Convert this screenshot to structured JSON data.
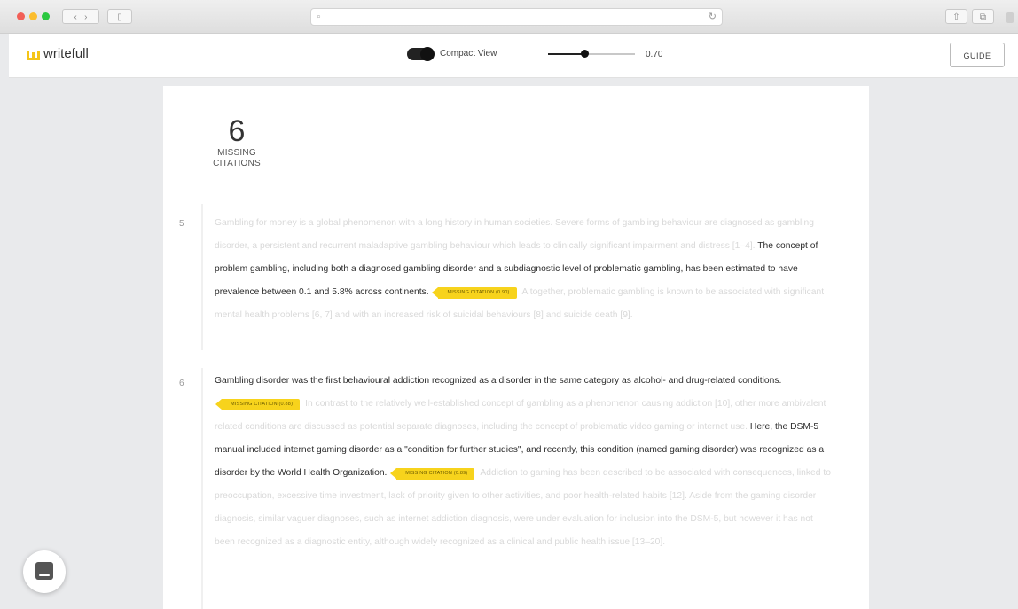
{
  "browser": {
    "url": ""
  },
  "app": {
    "name": "writefull"
  },
  "toolbar": {
    "compact_view_label": "Compact View",
    "compact_view_on": true,
    "slider_value": "0.70",
    "slider_fraction": 0.42,
    "guide_label": "GUIDE"
  },
  "counter": {
    "number": "6",
    "label_line1": "MISSING",
    "label_line2": "CITATIONS"
  },
  "paragraphs": [
    {
      "number": "5",
      "segments": [
        {
          "text": "Gambling for money is a global phenomenon with a long history in human societies. Severe forms of gambling behaviour are diagnosed as gambling disorder, a persistent and recurrent maladaptive gambling behaviour which leads to clinically significant impairment and distress [1–4].",
          "style": "faded"
        },
        {
          "text": "The concept of problem gambling, including both a diagnosed gambling disorder and a subdiagnostic level of problematic gambling, has been estimated to have prevalence between 0.1 and 5.8% across continents.",
          "style": "normal"
        },
        {
          "text": "MISSING CITATION (0.90)",
          "style": "tag"
        },
        {
          "text": "Altogether, problematic gambling is known to be associated with significant mental health problems [6, 7] and with an increased risk of suicidal behaviours [8] and suicide death [9].",
          "style": "faded"
        }
      ]
    },
    {
      "number": "6",
      "segments": [
        {
          "text": "Gambling disorder was the first behavioural addiction recognized as a disorder in the same category as alcohol- and drug-related conditions.",
          "style": "normal"
        },
        {
          "text": "MISSING CITATION (0.88)",
          "style": "tag"
        },
        {
          "text": "In contrast to the relatively well-established concept of gambling as a phenomenon causing addiction [10], other more ambivalent related conditions are discussed as potential separate diagnoses, including the concept of problematic video gaming or internet use.",
          "style": "faded"
        },
        {
          "text": "Here, the DSM-5 manual included internet gaming disorder as a \"condition for further studies\", and recently, this condition (named gaming disorder) was recognized as a disorder by the World Health Organization.",
          "style": "normal"
        },
        {
          "text": "MISSING CITATION (0.89)",
          "style": "tag"
        },
        {
          "text": "Addiction to gaming has been described to be associated with consequences, linked to preoccupation, excessive time investment, lack of priority given to other activities, and poor health-related habits [12]. Aside from the gaming disorder diagnosis, similar vaguer diagnoses, such as internet addiction diagnosis, were under evaluation for inclusion into the DSM-5, but however it has not been recognized as a diagnostic entity, although widely recognized as a clinical and public health issue [13–20].",
          "style": "faded"
        }
      ]
    }
  ],
  "colors": {
    "accent": "#f7d31c",
    "text": "#2c2c2c",
    "faded": "#d9d9d9",
    "logo": "#f5c518"
  },
  "icons": {
    "logo": "writefull-logo-icon",
    "chat": "chat-icon"
  }
}
